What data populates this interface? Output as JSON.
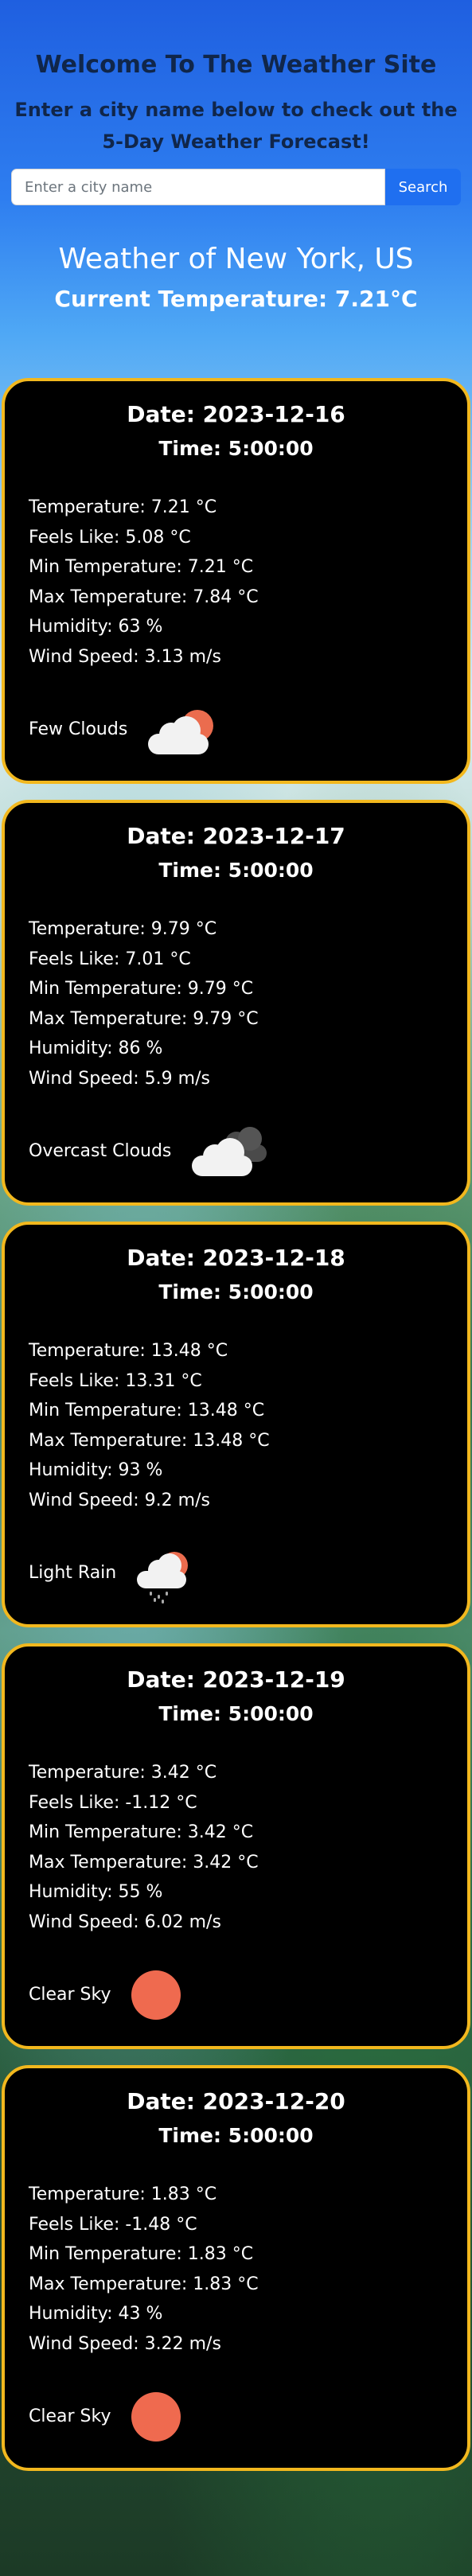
{
  "header": {
    "title": "Welcome To The Weather Site",
    "subtitle": "Enter a city name below to check out the 5-Day Weather Forecast!"
  },
  "search": {
    "placeholder": "Enter a city name",
    "value": "",
    "button_label": "Search"
  },
  "current": {
    "city_title": "Weather of New York, US",
    "temperature_text": "Current Temperature: 7.21°C"
  },
  "forecast": [
    {
      "date": "Date: 2023-12-16",
      "time": "Time: 5:00:00",
      "temperature": "Temperature: 7.21 °C",
      "feels_like": "Feels Like: 5.08 °C",
      "min_temp": "Min Temperature: 7.21 °C",
      "max_temp": "Max Temperature: 7.84 °C",
      "humidity": "Humidity: 63 %",
      "wind": "Wind Speed: 3.13 m/s",
      "description": "Few Clouds",
      "icon": "few-clouds-icon"
    },
    {
      "date": "Date: 2023-12-17",
      "time": "Time: 5:00:00",
      "temperature": "Temperature: 9.79 °C",
      "feels_like": "Feels Like: 7.01 °C",
      "min_temp": "Min Temperature: 9.79 °C",
      "max_temp": "Max Temperature: 9.79 °C",
      "humidity": "Humidity: 86 %",
      "wind": "Wind Speed: 5.9 m/s",
      "description": "Overcast Clouds",
      "icon": "overcast-clouds-icon"
    },
    {
      "date": "Date: 2023-12-18",
      "time": "Time: 5:00:00",
      "temperature": "Temperature: 13.48 °C",
      "feels_like": "Feels Like: 13.31 °C",
      "min_temp": "Min Temperature: 13.48 °C",
      "max_temp": "Max Temperature: 13.48 °C",
      "humidity": "Humidity: 93 %",
      "wind": "Wind Speed: 9.2 m/s",
      "description": "Light Rain",
      "icon": "light-rain-icon"
    },
    {
      "date": "Date: 2023-12-19",
      "time": "Time: 5:00:00",
      "temperature": "Temperature: 3.42 °C",
      "feels_like": "Feels Like: -1.12 °C",
      "min_temp": "Min Temperature: 3.42 °C",
      "max_temp": "Max Temperature: 3.42 °C",
      "humidity": "Humidity: 55 %",
      "wind": "Wind Speed: 6.02 m/s",
      "description": "Clear Sky",
      "icon": "clear-sky-icon"
    },
    {
      "date": "Date: 2023-12-20",
      "time": "Time: 5:00:00",
      "temperature": "Temperature: 1.83 °C",
      "feels_like": "Feels Like: -1.48 °C",
      "min_temp": "Min Temperature: 1.83 °C",
      "max_temp": "Max Temperature: 1.83 °C",
      "humidity": "Humidity: 43 %",
      "wind": "Wind Speed: 3.22 m/s",
      "description": "Clear Sky",
      "icon": "clear-sky-icon"
    }
  ],
  "colors": {
    "card_border": "#f2b81e",
    "card_background": "#000000",
    "button": "#1f6ff0",
    "heading_dark": "#10264a",
    "sun": "#ef6a4f"
  }
}
